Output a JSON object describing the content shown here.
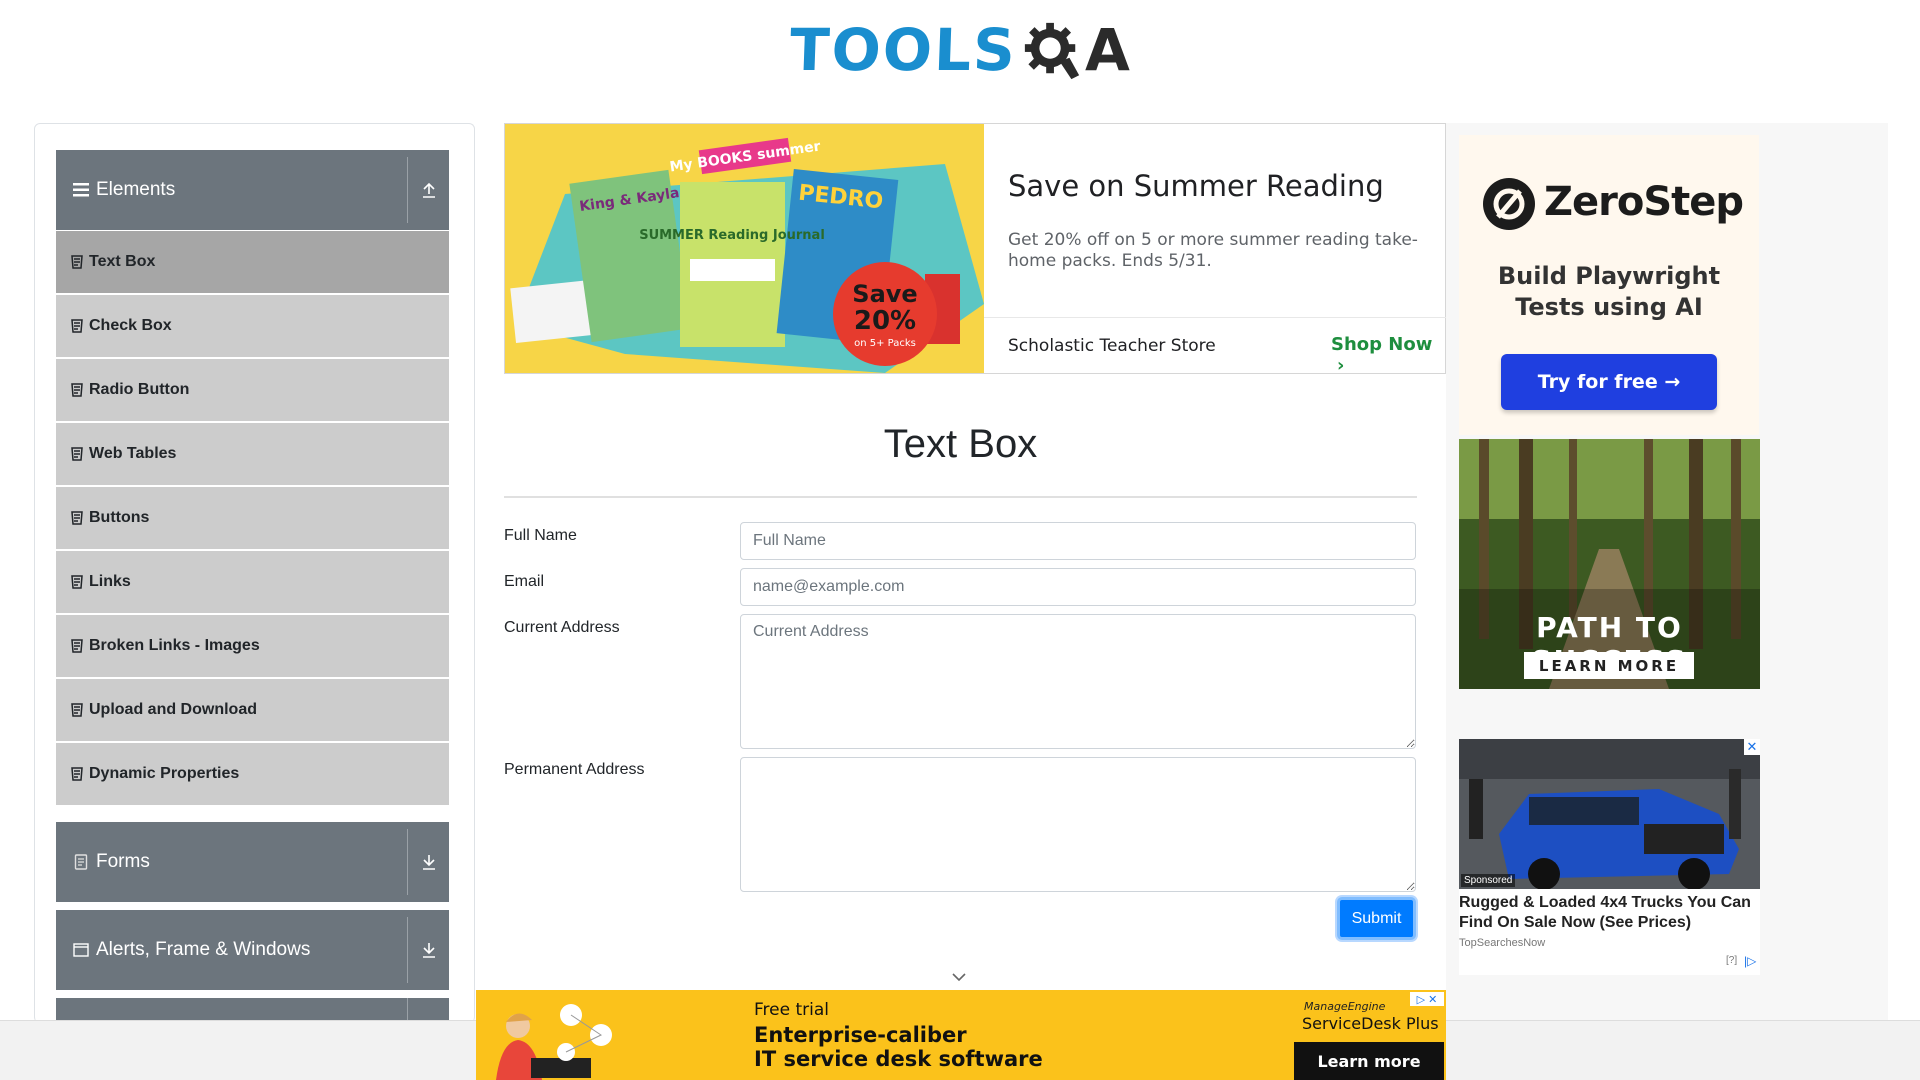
{
  "header": {
    "logo_text_left": "TOOLS",
    "logo_text_right": "A"
  },
  "sidebar": {
    "groups": [
      {
        "label": "Elements",
        "icon": "hamburger-icon",
        "toggle_icon": "collapse-up-icon"
      },
      {
        "label": "Forms",
        "icon": "document-icon",
        "toggle_icon": "expand-down-icon"
      },
      {
        "label": "Alerts, Frame & Windows",
        "icon": "window-icon",
        "toggle_icon": "expand-down-icon"
      }
    ],
    "items": [
      {
        "label": "Text Box"
      },
      {
        "label": "Check Box"
      },
      {
        "label": "Radio Button"
      },
      {
        "label": "Web Tables"
      },
      {
        "label": "Buttons"
      },
      {
        "label": "Links"
      },
      {
        "label": "Broken Links - Images"
      },
      {
        "label": "Upload and Download"
      },
      {
        "label": "Dynamic Properties"
      }
    ],
    "active_item": "Text Box"
  },
  "top_ad": {
    "image_texts": {
      "series": "My BOOKS summer",
      "book1": "King & Kayla",
      "book2": "SUMMER Reading Journal",
      "book3": "PEDRO",
      "badge_line1": "Save",
      "badge_line2": "20%",
      "badge_line3": "on 5+ Packs"
    },
    "title": "Save on Summer Reading",
    "description": "Get 20% off on 5 or more summer reading take-home packs. Ends 5/31.",
    "store": "Scholastic Teacher Store",
    "cta": "Shop Now"
  },
  "main": {
    "title": "Text Box",
    "fields": {
      "full_name": {
        "label": "Full Name",
        "placeholder": "Full Name",
        "value": ""
      },
      "email": {
        "label": "Email",
        "placeholder": "name@example.com",
        "value": ""
      },
      "current_address": {
        "label": "Current Address",
        "placeholder": "Current Address",
        "value": ""
      },
      "permanent_address": {
        "label": "Permanent Address",
        "placeholder": "",
        "value": ""
      }
    },
    "submit_label": "Submit"
  },
  "right_ads": {
    "zerostep": {
      "brand": "ZeroStep",
      "headline": "Build Playwright Tests using AI",
      "cta": "Try for free →"
    },
    "forest": {
      "title": "PATH TO SUCCESS",
      "cta": "LEARN MORE"
    },
    "truck": {
      "sponsored": "Sponsored",
      "title": "Rugged & Loaded 4x4 Trucks You Can Find On Sale Now (See Prices)",
      "source": "TopSearchesNow",
      "adchoice": "[?]"
    }
  },
  "bottom_ad": {
    "trial": "Free trial",
    "line1": "Enterprise-caliber",
    "line2": "IT service desk software",
    "brand": "ManageEngine",
    "product": "ServiceDesk Plus",
    "cta": "Learn more"
  },
  "colors": {
    "primary": "#007bff",
    "sidebar_header": "#6c757d",
    "sidebar_item": "#cccccc",
    "sidebar_active": "#a6a6a6",
    "logo_blue": "#1a8ecf",
    "ad_green": "#1e8e3e",
    "bottom_ad_yellow": "#fbc21b"
  }
}
